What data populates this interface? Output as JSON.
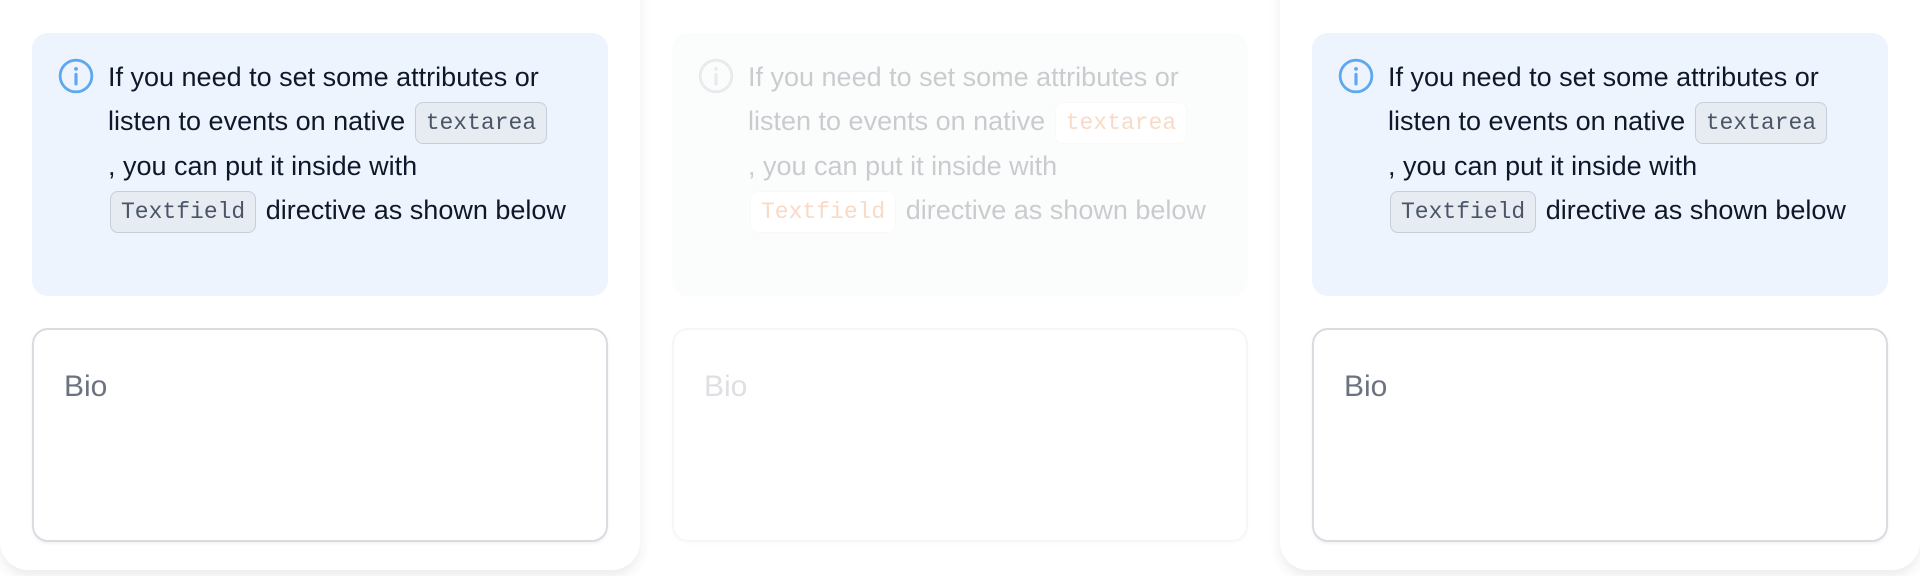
{
  "panels": [
    {
      "alert": {
        "icon": "info-circle-icon",
        "text_before": "If you need to set some attributes or listen to events on native",
        "code_1": "textarea",
        "text_middle": ", you can put it inside with",
        "code_2": "Textfield",
        "text_after": "directive as shown below"
      },
      "textfield": {
        "label": "Bio"
      }
    },
    {
      "alert": {
        "icon": "info-circle-icon",
        "text_before": "If you need to set some attributes or listen to events on native",
        "code_1": "textarea",
        "text_middle": ", you can put it inside with",
        "code_2": "Textfield",
        "text_after": "directive as shown below"
      },
      "textfield": {
        "label": "Bio"
      }
    },
    {
      "alert": {
        "icon": "info-circle-icon",
        "text_before": "If you need to set some attributes or listen to events on native",
        "code_1": "textarea",
        "text_middle": ", you can put it inside with",
        "code_2": "Textfield",
        "text_after": "directive as shown below"
      },
      "textfield": {
        "label": "Bio"
      }
    }
  ],
  "colors": {
    "alert_bg": "#EDF4FD",
    "info_icon": "#5FA8F0",
    "text": "#0F172A",
    "label": "#6B7280",
    "code_accent_disabled": "#E45A00"
  }
}
